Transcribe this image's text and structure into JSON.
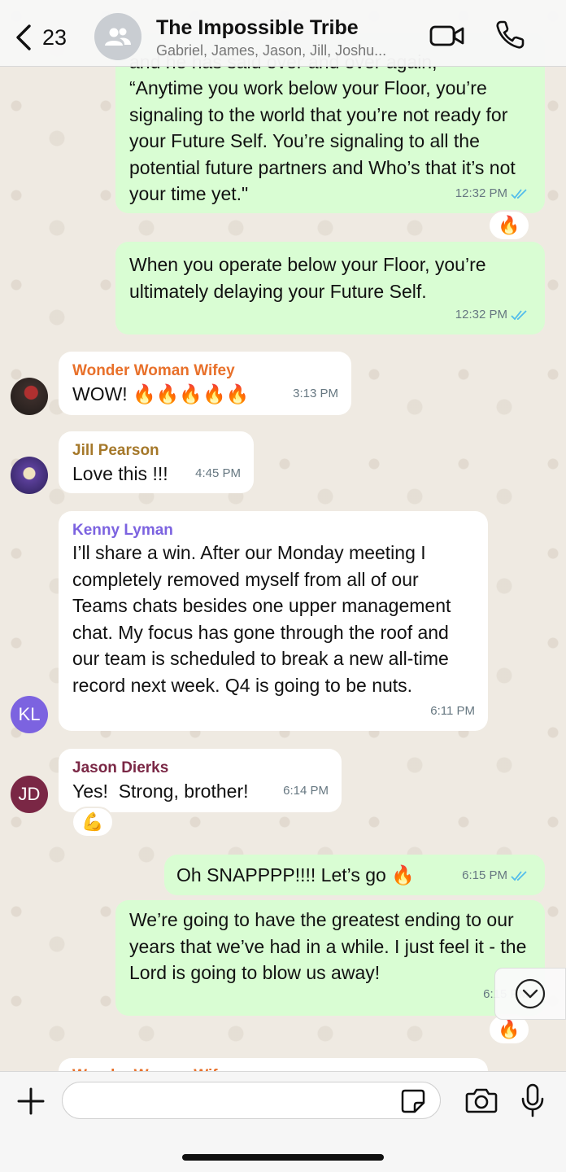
{
  "header": {
    "back_count": "23",
    "title": "The Impossible Tribe",
    "members": "Gabriel, James, Jason, Jill, Joshu..."
  },
  "messages": {
    "m1": {
      "top_text": "and he has said over and over again,",
      "text": "“Anytime you work below your Floor, you’re signaling to the world that you’re not ready for your Future Self. You’re signaling to all the potential future partners and Who’s that it’s not your time yet.\"",
      "time": "12:32 PM",
      "reaction": "🔥"
    },
    "m2": {
      "text": "When you operate below your Floor, you’re ultimately delaying your Future Self.",
      "time": "12:32 PM"
    },
    "m3": {
      "sender": "Wonder Woman Wifey",
      "sender_color": "#e8702a",
      "text": "WOW! 🔥🔥🔥🔥🔥",
      "time": "3:13 PM"
    },
    "m4": {
      "sender": "Jill Pearson",
      "sender_color": "#a5782a",
      "text": "Love this !!!",
      "time": "4:45 PM"
    },
    "m5": {
      "sender": "Kenny Lyman",
      "sender_color": "#7c63e0",
      "avatar_initials": "KL",
      "text": "I’ll share a win. After our Monday meeting I completely removed myself from all of our Teams chats besides one upper management chat. My focus has gone through the roof and our team is scheduled to break a new all-time record next week. Q4 is going to be nuts.",
      "time": "6:11 PM"
    },
    "m6": {
      "sender": "Jason Dierks",
      "sender_color": "#7a2745",
      "avatar_initials": "JD",
      "text": "Yes!  Strong, brother!",
      "time": "6:14 PM",
      "reaction": "💪"
    },
    "m7": {
      "text": "Oh SNAPPPP!!!! Let’s go 🔥",
      "time": "6:15 PM"
    },
    "m8": {
      "text": "We’re going to have the greatest ending to our years that we’ve had in a while. I just feel it - the Lord is going to blow us away!",
      "time": "6:15 PM",
      "reaction": "🔥"
    },
    "m9": {
      "sender": "Wonder Woman Wifey"
    }
  },
  "input": {
    "placeholder": ""
  },
  "colors": {
    "outgoing_bubble": "#d9fdd3",
    "incoming_bubble": "#ffffff",
    "read_ticks": "#53bdeb",
    "chat_background": "#efeae2"
  },
  "icons": [
    "chevron-left-icon",
    "group-icon",
    "video-call-icon",
    "phone-icon",
    "plus-icon",
    "sticker-icon",
    "camera-icon",
    "microphone-icon",
    "chevron-down-icon",
    "double-check-icon"
  ]
}
